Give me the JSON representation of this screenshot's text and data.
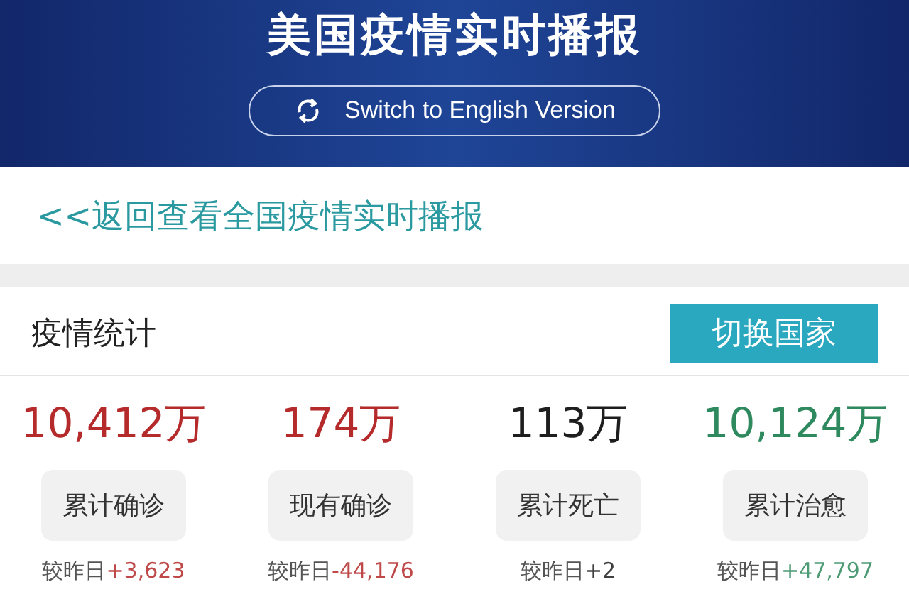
{
  "header": {
    "title": "美国疫情实时播报",
    "language_button": "Switch to English Version"
  },
  "back_link": "<<返回查看全国疫情实时播报",
  "stats_card": {
    "title": "疫情统计",
    "switch_button": "切换国家",
    "stats": [
      {
        "value": "10,412万",
        "label": "累计确诊",
        "delta_label": "较昨日",
        "delta": "+3,623",
        "color": "#b52a2a"
      },
      {
        "value": "174万",
        "label": "现有确诊",
        "delta_label": "较昨日",
        "delta": "-44,176",
        "color": "#b52a2a"
      },
      {
        "value": "113万",
        "label": "累计死亡",
        "delta_label": "较昨日",
        "delta": "+2",
        "color": "#1e1e1e"
      },
      {
        "value": "10,124万",
        "label": "累计治愈",
        "delta_label": "较昨日",
        "delta": "+47,797",
        "color": "#2e8a5e"
      }
    ]
  }
}
